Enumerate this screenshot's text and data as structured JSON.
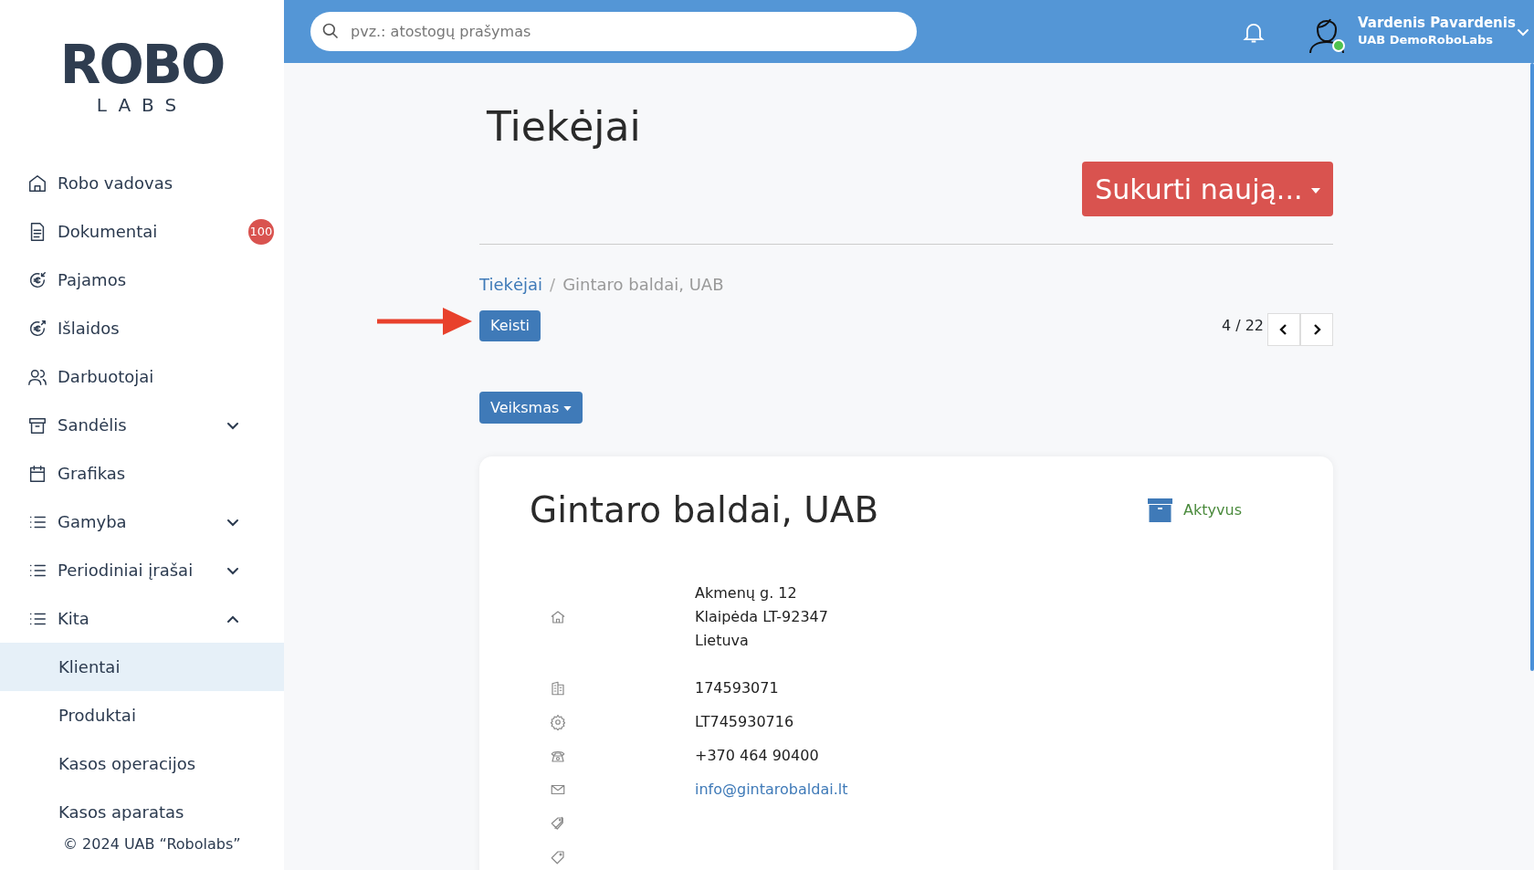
{
  "sidebar": {
    "logo": {
      "top": "ROBO",
      "bottom": "LABS"
    },
    "items": [
      {
        "label": "Robo vadovas",
        "kind": "home",
        "selected": false
      },
      {
        "label": "Dokumentai",
        "kind": "doc",
        "badge": "100",
        "selected": false
      },
      {
        "label": "Pajamos",
        "kind": "euro-in",
        "selected": false
      },
      {
        "label": "Išlaidos",
        "kind": "euro-out",
        "selected": false
      },
      {
        "label": "Darbuotojai",
        "kind": "people",
        "selected": false
      },
      {
        "label": "Sandėlis",
        "kind": "box",
        "expanded": false,
        "selected": false
      },
      {
        "label": "Grafikas",
        "kind": "calendar",
        "selected": false
      },
      {
        "label": "Gamyba",
        "kind": "list",
        "expanded": false,
        "selected": false
      },
      {
        "label": "Periodiniai įrašai",
        "kind": "list",
        "expanded": false,
        "selected": false
      },
      {
        "label": "Kita",
        "kind": "list",
        "expanded": true,
        "selected": false,
        "children": [
          {
            "label": "Klientai",
            "selected": true
          },
          {
            "label": "Produktai",
            "selected": false
          },
          {
            "label": "Kasos operacijos",
            "selected": false
          },
          {
            "label": "Kasos aparatas",
            "selected": false
          }
        ]
      }
    ],
    "footer": "© 2024 UAB “Robolabs”"
  },
  "header": {
    "search": {
      "placeholder": "pvz.: atostogų prašymas"
    },
    "user": {
      "name": "Vardenis Pavardenis",
      "company": "UAB DemoRoboLabs",
      "online": true
    }
  },
  "page": {
    "title": "Tiekėjai",
    "create_button": "Sukurti naują...",
    "breadcrumb_separator": "/",
    "breadcrumb": [
      {
        "label": "Tiekėjai",
        "link": true
      },
      {
        "label": "Gintaro baldai, UAB",
        "link": false
      }
    ],
    "edit_button": "Keisti",
    "pager": "4 / 22",
    "action_button": "Veiksmas",
    "card": {
      "title": "Gintaro baldai, UAB",
      "status": "Aktyvus",
      "rows": [
        {
          "kind": "address",
          "lines": [
            "Akmenų g. 12",
            "Klaipėda LT-92347",
            "Lietuva"
          ]
        },
        {
          "kind": "building",
          "lines": [
            "174593071"
          ]
        },
        {
          "kind": "gear",
          "lines": [
            "LT745930716"
          ]
        },
        {
          "kind": "phone",
          "lines": [
            "+370 464 90400"
          ]
        },
        {
          "kind": "mail",
          "lines": [
            "info@gintarobaldai.lt"
          ],
          "link": true
        },
        {
          "kind": "tags"
        },
        {
          "kind": "tag"
        }
      ]
    }
  }
}
